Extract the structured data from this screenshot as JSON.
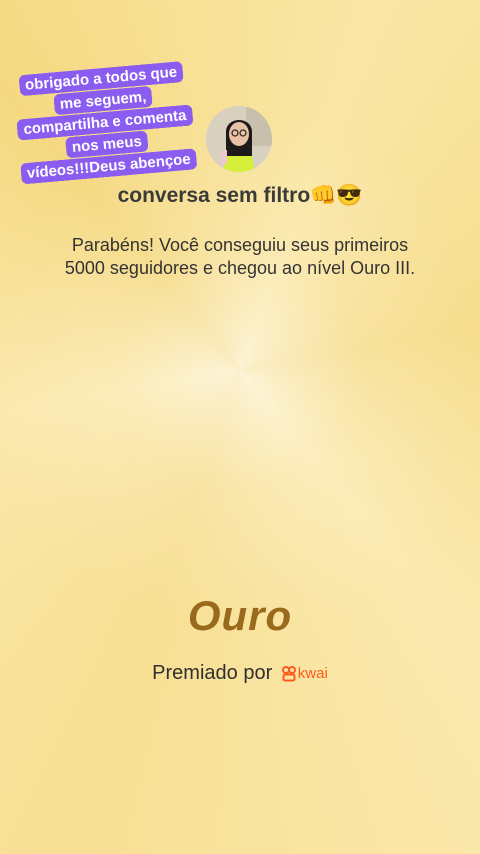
{
  "sticker": {
    "text": "obrigado a todos que me seguem, compartilha e comenta nos meus vídeos!!!Deus abençoe"
  },
  "profile": {
    "name": "conversa sem filtro👊😎"
  },
  "achievement": {
    "message": "Parabéns! Você conseguiu seus primeiros 5000 seguidores e chegou ao nível Ouro III.",
    "level": "Ouro"
  },
  "footer": {
    "awarded_by": "Premiado por",
    "brand": "kwai"
  },
  "colors": {
    "sticker_bg": "#8a5cf0",
    "level_text": "#9a6a1c",
    "brand": "#ff5a1f"
  }
}
